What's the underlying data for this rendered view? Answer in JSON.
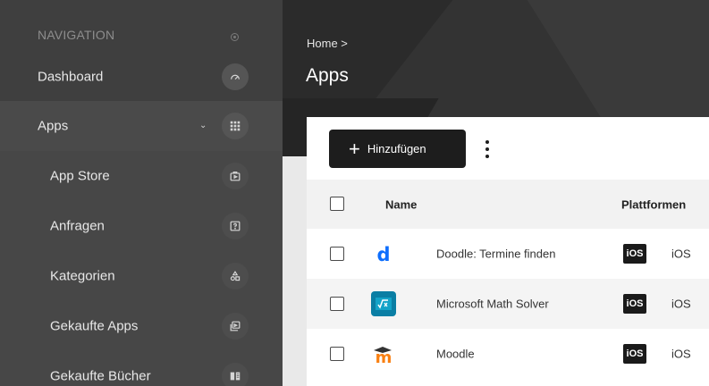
{
  "sidebar": {
    "header": "NAVIGATION",
    "items": [
      {
        "label": "Dashboard",
        "icon": "gauge-icon"
      },
      {
        "label": "Apps",
        "icon": "grid-icon"
      },
      {
        "label": "App Store",
        "icon": "store-icon"
      },
      {
        "label": "Anfragen",
        "icon": "request-icon"
      },
      {
        "label": "Kategorien",
        "icon": "categories-icon"
      },
      {
        "label": "Gekaufte Apps",
        "icon": "purchased-apps-icon"
      },
      {
        "label": "Gekaufte Bücher",
        "icon": "book-icon"
      }
    ]
  },
  "header": {
    "breadcrumb": "Home >",
    "title": "Apps"
  },
  "toolbar": {
    "add_label": "Hinzufügen"
  },
  "table": {
    "columns": [
      "Name",
      "Plattformen"
    ],
    "rows": [
      {
        "name": "Doodle: Termine finden",
        "badge": "iOS",
        "platform": "iOS",
        "icon": "doodle-icon"
      },
      {
        "name": "Microsoft Math Solver",
        "badge": "iOS",
        "platform": "iOS",
        "icon": "math-solver-icon"
      },
      {
        "name": "Moodle",
        "badge": "iOS",
        "platform": "iOS",
        "icon": "moodle-icon"
      }
    ]
  },
  "colors": {
    "sidebar": "#3f3f3f",
    "header": "#2b2b2b",
    "button": "#1d1d1d",
    "doodle": "#0d6efd",
    "moodle": "#f98012",
    "math": "#0a7ea4"
  }
}
